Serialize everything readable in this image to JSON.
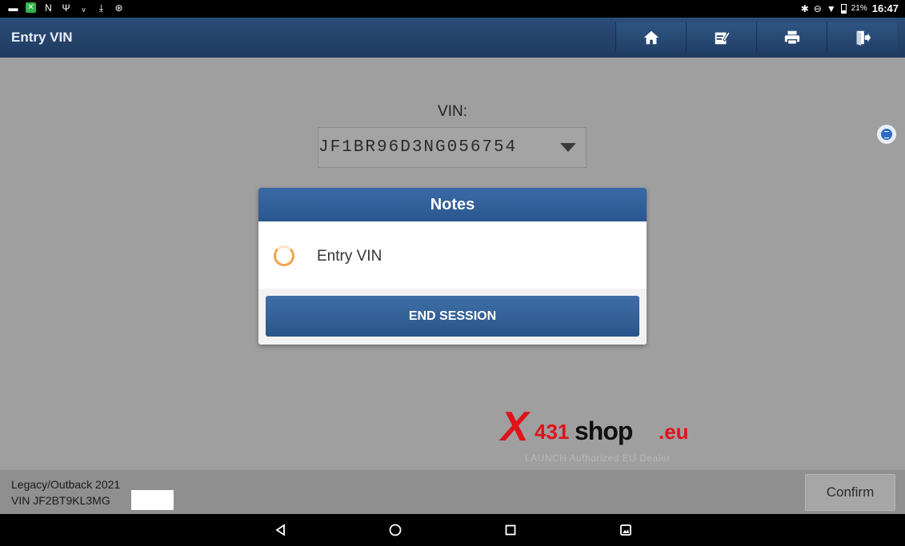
{
  "status_bar": {
    "left_icons": [
      "image-icon",
      "app-icon",
      "n-icon",
      "usb-icon",
      "signal-icon",
      "download-icon",
      "bluetooth-badge-icon"
    ],
    "battery_percent": "21%",
    "time": "16:47"
  },
  "header": {
    "title": "Entry VIN",
    "buttons": [
      "home-icon",
      "edit-icon",
      "print-icon",
      "exit-icon"
    ]
  },
  "main": {
    "vin_label": "VIN:",
    "vin_value": "JF1BR96D3NG056754"
  },
  "watermark": {
    "x": "X",
    "number": "431",
    "shop": "shop",
    "domain": ".eu",
    "tagline": "LAUNCH Authorized EU Dealer"
  },
  "modal": {
    "title": "Notes",
    "message": "Entry VIN",
    "button_label": "END SESSION"
  },
  "footer": {
    "vehicle": "Legacy/Outback 2021",
    "vin_partial": "VIN JF2BT9KL3MG",
    "confirm_label": "Confirm"
  },
  "colors": {
    "header": "#2c4d78",
    "modal_header": "#3a6aa6",
    "button": "#2a5589",
    "spinner": "#f6a14a",
    "watermark_red": "#e0121a",
    "background": "#9f9f9f"
  }
}
